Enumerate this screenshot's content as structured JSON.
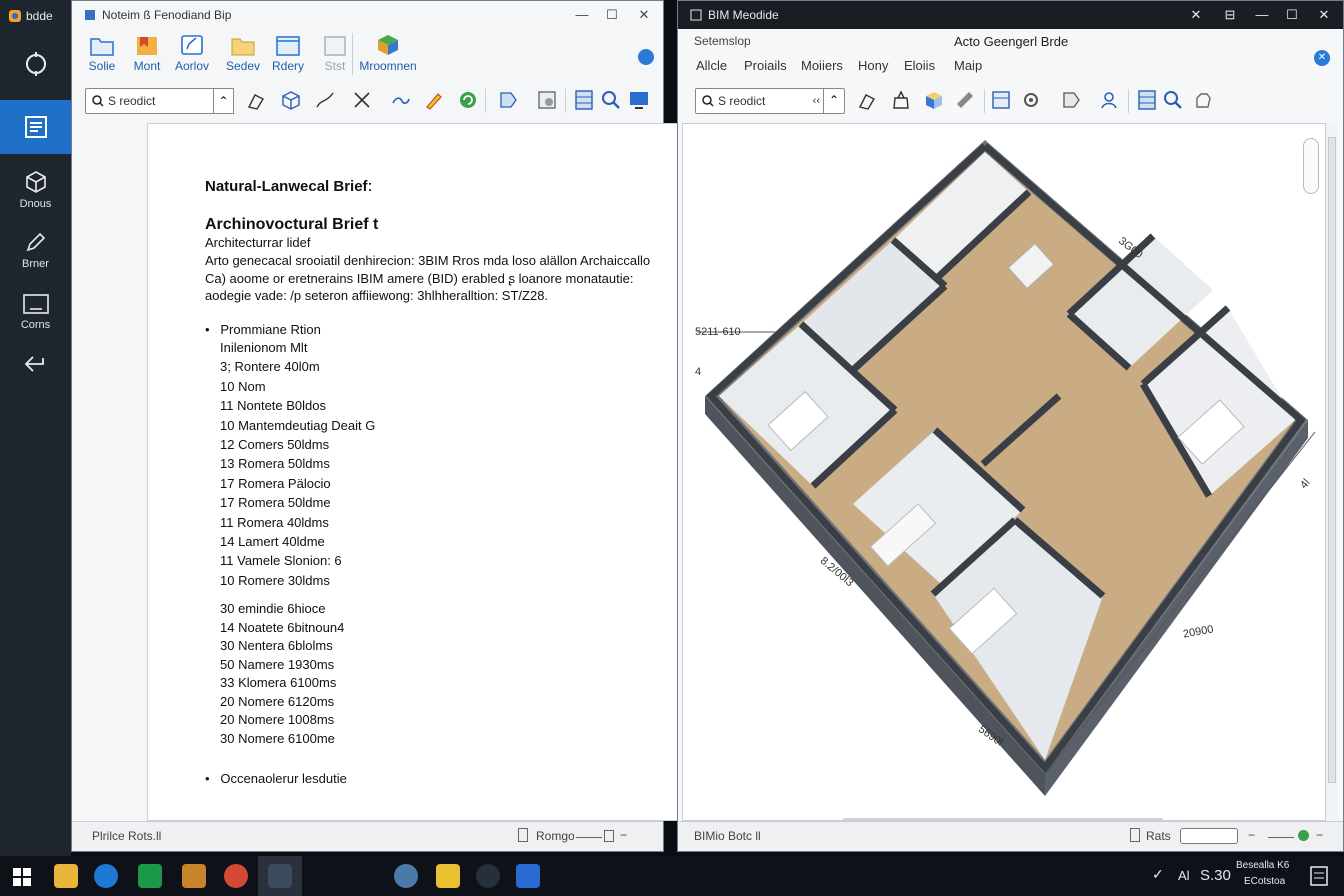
{
  "leftbar": {
    "app_name": "bdde",
    "items": [
      {
        "label": "",
        "icon": "target-icon"
      },
      {
        "label": "",
        "icon": "document-list-icon"
      },
      {
        "label": "Dnous",
        "icon": "cube-icon"
      },
      {
        "label": "Brner",
        "icon": "pen-icon"
      },
      {
        "label": "Corns",
        "icon": "frame-icon"
      },
      {
        "label": "",
        "icon": "back-arrow-icon"
      }
    ]
  },
  "left_window": {
    "title": "Noteim ß Fenodiand Bip",
    "ribbon": [
      {
        "label": "Solie",
        "icon": "folder-icon"
      },
      {
        "label": "Mont",
        "icon": "bookmark-folder-icon"
      },
      {
        "label": "Aorlov",
        "icon": "edit-box-icon"
      },
      {
        "label": "Sedev",
        "icon": "folder-yellow-icon"
      },
      {
        "label": "Rdery",
        "icon": "window-icon"
      },
      {
        "label": "Stst",
        "icon": "frame-gray-icon"
      },
      {
        "label": "Mroomnen",
        "icon": "colored-cube-icon"
      }
    ],
    "search_value": "S reodict",
    "doc": {
      "heading1": "Natural-Lanwecal Briefː",
      "heading2": "Archinovoctural Brief t",
      "subheading": "Architecturrar lidef",
      "para": [
        "Arto genecacal srooiatil denhirecion: 3BIM Rros mda loso alällon Archaiccallo",
        "Ca) aoome or eretnerains IBIM amere (BID) erabled ʂ loanore monatautie:",
        "aodegie vade: /p seteron affiiewong: 3hlhheralltion: ST/Z28."
      ],
      "bullet1": "Prommiane Rtion",
      "list1": [
        "Inilenionom Mlt",
        "3; Rontere 40l0m",
        "10 Nom",
        "11 Nontete B0ldos",
        "10 Mantemdeutiag Deait G",
        "12 Comers 50ldms",
        "13 Romera 50ldms",
        "17 Romera Pälocio",
        "17 Romera 50ldme",
        "11 Romera 40ldms",
        "14 Lamert 40ldme",
        "11 Vamele Slonion: 6",
        "10 Romere 30ldms"
      ],
      "list2": [
        "30 emindie 6hioce",
        "14 Noatete 6bitnoun4",
        "30 Nentera 6blolms",
        "50 Namere 1930ms",
        "33 Klomera 6100ms",
        "20 Nomere 6120ms",
        "20 Nomere 1008ms",
        "30 Nomere 6100me"
      ],
      "bullet2": "Occenaolerur lesdutie"
    },
    "status_left": "Plrilce Rots.ll",
    "status_right": "Romgo"
  },
  "right_window": {
    "title": "BIM Meodide",
    "menu_left": "Setemslop",
    "menu_center": "Acto Geengerl Brde",
    "menu_items": [
      "Allcle",
      "Proiails",
      "Moiiers",
      "Hony",
      "Eloiis",
      "Maip"
    ],
    "search_value": "S reodict",
    "dimensions": {
      "top_right": "3G00",
      "left_top": "5211-610",
      "left_small": "4",
      "left_bottom": "8.2/00l3",
      "bottom_right": "20900",
      "bottom": "5690l",
      "right_edge": "4l"
    },
    "status_left": "BIMio Botc ll",
    "status_right": "Rats"
  },
  "taskbar": {
    "time": "S.30",
    "signal": "Al",
    "notif_line1": "Besealla K6",
    "notif_line2": "ECotstoa"
  },
  "colors": {
    "accent": "#1d6fc8",
    "sidebar": "#20262e",
    "taskbar": "#0e1218",
    "floor": "#c9ab84"
  }
}
